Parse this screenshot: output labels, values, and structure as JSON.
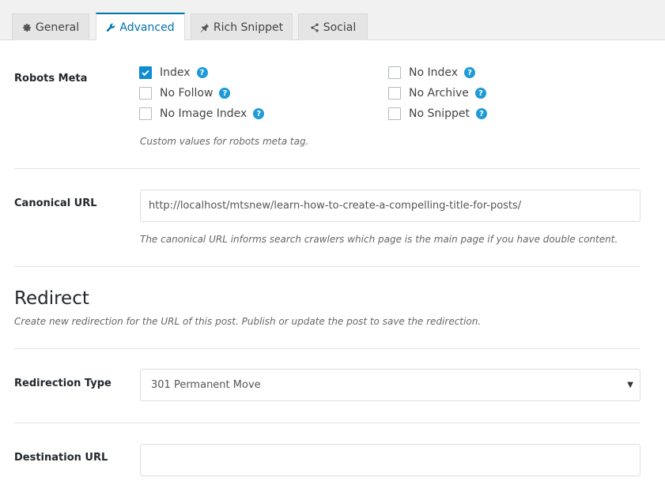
{
  "tabs": [
    {
      "label": "General",
      "icon": "gear-icon"
    },
    {
      "label": "Advanced",
      "icon": "wrench-icon"
    },
    {
      "label": "Rich Snippet",
      "icon": "pin-icon"
    },
    {
      "label": "Social",
      "icon": "share-icon"
    }
  ],
  "robots": {
    "label": "Robots Meta",
    "options": [
      {
        "label": "Index",
        "checked": true
      },
      {
        "label": "No Index",
        "checked": false
      },
      {
        "label": "No Follow",
        "checked": false
      },
      {
        "label": "No Archive",
        "checked": false
      },
      {
        "label": "No Image Index",
        "checked": false
      },
      {
        "label": "No Snippet",
        "checked": false
      }
    ],
    "description": "Custom values for robots meta tag."
  },
  "canonical": {
    "label": "Canonical URL",
    "value": "http://localhost/mtsnew/learn-how-to-create-a-compelling-title-for-posts/",
    "description": "The canonical URL informs search crawlers which page is the main page if you have double content."
  },
  "redirect": {
    "title": "Redirect",
    "description": "Create new redirection for the URL of this post. Publish or update the post to save the redirection.",
    "type_label": "Redirection Type",
    "type_value": "301 Permanent Move",
    "destination_label": "Destination URL",
    "destination_value": ""
  },
  "colors": {
    "accent": "#0073aa",
    "checkbox": "#0e8bd1",
    "help": "#1e9bd7"
  }
}
